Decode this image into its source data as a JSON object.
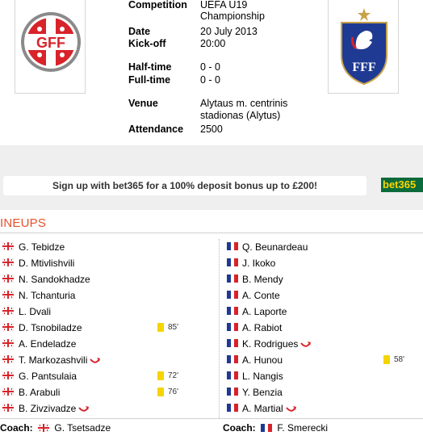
{
  "match": {
    "home_crest_text": "GFF",
    "away_crest_text": "FFF",
    "competition_label": "Competition",
    "competition_value": "UEFA U19 Championship",
    "date_label": "Date",
    "date_value": "20 July 2013",
    "kickoff_label": "Kick-off",
    "kickoff_value": "20:00",
    "halftime_label": "Half-time",
    "halftime_value": "0 - 0",
    "fulltime_label": "Full-time",
    "fulltime_value": "0 - 0",
    "venue_label": "Venue",
    "venue_value": "Alytaus m. centrinis stadionas (Alytus)",
    "attendance_label": "Attendance",
    "attendance_value": "2500"
  },
  "promo": {
    "text": "Sign up with bet365 for a 100% deposit bonus up to £200!",
    "logo_text": "bet365"
  },
  "lineups": {
    "title": "INEUPS",
    "home": [
      {
        "name": "G. Tebidze"
      },
      {
        "name": "D. Mtivlishvili"
      },
      {
        "name": "N. Sandokhadze"
      },
      {
        "name": "N. Tchanturia"
      },
      {
        "name": "L. Dvali"
      },
      {
        "name": "D. Tsnobiladze",
        "card_minute": "85'"
      },
      {
        "name": "A. Endeladze"
      },
      {
        "name": "T. Markozashvili",
        "subbed": true
      },
      {
        "name": "G. Pantsulaia",
        "card_minute": "72'"
      },
      {
        "name": "B. Arabuli",
        "card_minute": "76'"
      },
      {
        "name": "B. Zivzivadze",
        "subbed": true
      }
    ],
    "away": [
      {
        "name": "Q. Beunardeau"
      },
      {
        "name": "J. Ikoko"
      },
      {
        "name": "B. Mendy"
      },
      {
        "name": "A. Conte"
      },
      {
        "name": "A. Laporte"
      },
      {
        "name": "A. Rabiot"
      },
      {
        "name": "K. Rodrigues",
        "subbed": true
      },
      {
        "name": "A. Hunou",
        "card_minute": "58'"
      },
      {
        "name": "L. Nangis"
      },
      {
        "name": "Y. Benzia"
      },
      {
        "name": "A. Martial",
        "subbed": true
      }
    ],
    "home_coach_label": "Coach:",
    "home_coach": "G. Tsetsadze",
    "away_coach_label": "Coach:",
    "away_coach": "F. Smerecki"
  },
  "colors": {
    "accent": "#e8502a",
    "card_yellow": "#f5d400",
    "georgia_red": "#d8232a",
    "france_blue": "#1f3a93"
  },
  "icons": {
    "home_flag": "georgia-flag-icon",
    "away_flag": "france-flag-icon",
    "substitution": "sub-arrow-icon",
    "card": "yellow-card-icon"
  }
}
